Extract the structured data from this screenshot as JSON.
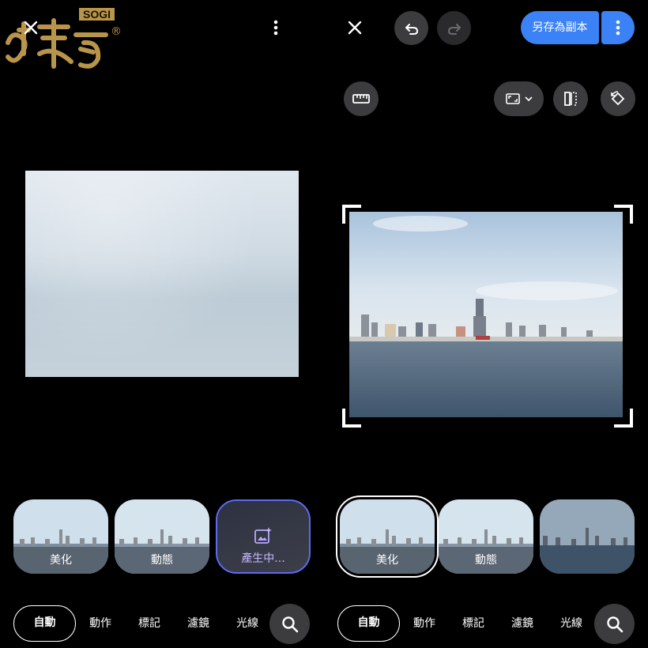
{
  "watermark": {
    "brand": "SOGI",
    "registered": "®",
    "logo_text": "手機王"
  },
  "left_panel": {
    "close_icon": "close-icon",
    "more_icon": "more-vert-icon",
    "chips": [
      {
        "label": "美化"
      },
      {
        "label": "動態"
      },
      {
        "label": "產生中..."
      }
    ],
    "tabs": [
      "自動",
      "動作",
      "標記",
      "濾鏡",
      "光線"
    ],
    "active_tab": "自動",
    "search_icon": "search-icon"
  },
  "right_panel": {
    "toolbar": {
      "close_icon": "close-icon",
      "undo_icon": "undo-icon",
      "redo_icon": "redo-icon",
      "save_label": "另存為副本",
      "more_icon": "more-vert-icon"
    },
    "tools": {
      "ruler_icon": "ruler-icon",
      "aspect_icon": "aspect-ratio-icon",
      "flip_icon": "flip-icon",
      "rotate_icon": "rotate-icon"
    },
    "chips": [
      {
        "label": "美化",
        "selected": true
      },
      {
        "label": "動態"
      },
      {
        "label": ""
      }
    ],
    "tabs": [
      "自動",
      "動作",
      "標記",
      "濾鏡",
      "光線"
    ],
    "active_tab": "自動",
    "search_icon": "search-icon"
  },
  "colors": {
    "accent": "#3b82f6",
    "background": "#000000",
    "button_dark": "#3c3c3e"
  }
}
